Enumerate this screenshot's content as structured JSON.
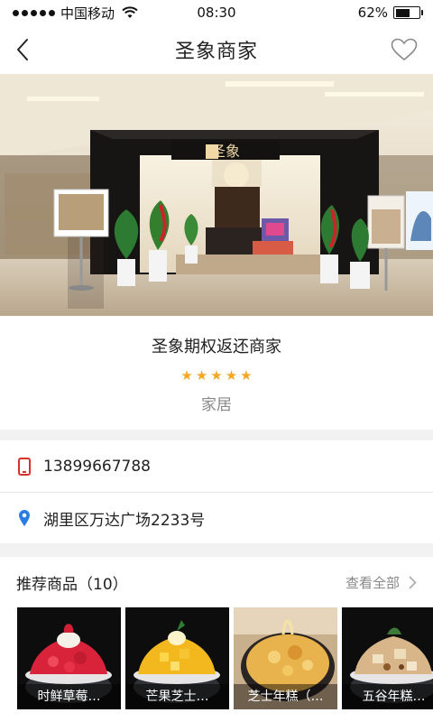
{
  "status_bar": {
    "carrier": "中国移动",
    "time": "08:30",
    "battery": "62%",
    "battery_level": 0.62
  },
  "nav": {
    "title": "圣象商家",
    "back_icon": "chevron-left-icon",
    "favorite_icon": "heart-outline-icon"
  },
  "hero": {
    "sign_text": "圣象",
    "image": "store-front-photo"
  },
  "merchant": {
    "name": "圣象期权返还商家",
    "rating": 5,
    "stars": [
      "★",
      "★",
      "★",
      "★",
      "★"
    ],
    "category": "家居"
  },
  "contact": {
    "phone": "13899667788",
    "address": "湖里区万达广场2233号",
    "phone_icon": "phone-icon",
    "location_icon": "location-pin-icon"
  },
  "recommend": {
    "title": "推荐商品（10）",
    "view_all": "查看全部",
    "products": [
      {
        "label": "时鲜草莓…"
      },
      {
        "label": "芒果芝士…"
      },
      {
        "label": "芝士年糕（…"
      },
      {
        "label": "五谷年糕…"
      }
    ]
  },
  "colors": {
    "accent_star": "#f5a623",
    "phone_icon": "#d9302c",
    "location_icon": "#2a7de1",
    "background": "#f2f2f2"
  }
}
